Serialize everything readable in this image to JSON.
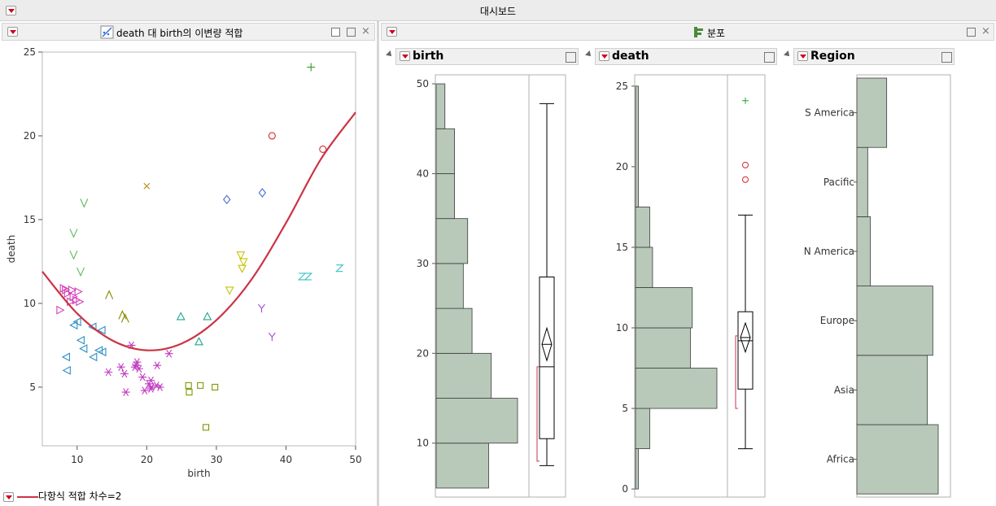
{
  "window": {
    "title": "대시보드"
  },
  "left_panel": {
    "title": "death 대 birth의 이변량 적합",
    "legend": "다항식 적합 차수=2"
  },
  "right_panel": {
    "title": "분포"
  },
  "distributions": [
    {
      "name": "birth"
    },
    {
      "name": "death"
    },
    {
      "name": "Region"
    }
  ],
  "chart_data": [
    {
      "type": "scatter",
      "xlabel": "birth",
      "ylabel": "death",
      "xlim": [
        5,
        50
      ],
      "ylim": [
        1.5,
        25
      ],
      "xticks": [
        10,
        20,
        30,
        40,
        50
      ],
      "yticks": [
        5,
        10,
        15,
        20,
        25
      ],
      "fit_line": {
        "label": "다항식 적합 차수=2",
        "color": "#cc3344",
        "points": [
          [
            5,
            11.9
          ],
          [
            10,
            9.4
          ],
          [
            15,
            7.8
          ],
          [
            20,
            7.2
          ],
          [
            25,
            7.6
          ],
          [
            30,
            9.0
          ],
          [
            35,
            11.4
          ],
          [
            40,
            14.8
          ],
          [
            45,
            18.6
          ],
          [
            50,
            21.4
          ]
        ]
      },
      "groups": [
        {
          "marker": "+",
          "color": "#2ca02c",
          "points": [
            [
              43.6,
              24.1
            ]
          ]
        },
        {
          "marker": "o",
          "color": "#d62728",
          "points": [
            [
              38.0,
              20.0
            ],
            [
              45.3,
              19.2
            ]
          ]
        },
        {
          "marker": "x",
          "color": "#b8860b",
          "points": [
            [
              20.0,
              17.0
            ]
          ]
        },
        {
          "marker": "diamond",
          "color": "#4a6fd4",
          "points": [
            [
              31.5,
              16.2
            ],
            [
              36.6,
              16.6
            ]
          ]
        },
        {
          "marker": "V",
          "color": "#5cb85c",
          "points": [
            [
              11.0,
              16.0
            ],
            [
              9.5,
              14.2
            ],
            [
              9.5,
              12.9
            ],
            [
              10.5,
              11.9
            ]
          ]
        },
        {
          "marker": "tri-down",
          "color": "#c9c100",
          "points": [
            [
              33.5,
              12.9
            ],
            [
              33.9,
              12.5
            ],
            [
              33.7,
              12.1
            ],
            [
              31.9,
              10.8
            ]
          ]
        },
        {
          "marker": "Z",
          "color": "#3bbfc4",
          "points": [
            [
              42.3,
              11.6
            ],
            [
              43.2,
              11.6
            ],
            [
              47.7,
              12.1
            ]
          ]
        },
        {
          "marker": "Y",
          "color": "#a04ad4",
          "points": [
            [
              36.5,
              9.7
            ],
            [
              38.0,
              8.0
            ]
          ]
        },
        {
          "marker": "A",
          "color": "#8a8a00",
          "points": [
            [
              14.6,
              10.5
            ],
            [
              16.5,
              9.3
            ],
            [
              16.9,
              9.1
            ]
          ]
        },
        {
          "marker": "tri-right",
          "color": "#d43fb8",
          "points": [
            [
              7.5,
              9.6
            ],
            [
              8.0,
              10.9
            ],
            [
              8.3,
              10.8
            ],
            [
              9.0,
              10.1
            ],
            [
              9.2,
              10.8
            ],
            [
              9.4,
              10.4
            ],
            [
              9.8,
              10.2
            ],
            [
              10.1,
              10.7
            ],
            [
              10.3,
              10.1
            ],
            [
              8.6,
              10.6
            ]
          ]
        },
        {
          "marker": "tri-up",
          "color": "#1aa88a",
          "points": [
            [
              24.9,
              9.2
            ],
            [
              28.7,
              9.2
            ],
            [
              27.5,
              7.7
            ]
          ]
        },
        {
          "marker": "tri-left",
          "color": "#2a8fc4",
          "points": [
            [
              9.6,
              8.7
            ],
            [
              10.1,
              8.9
            ],
            [
              12.3,
              8.6
            ],
            [
              13.6,
              8.4
            ],
            [
              10.6,
              7.8
            ],
            [
              12.4,
              6.8
            ],
            [
              11.0,
              7.3
            ],
            [
              13.2,
              7.2
            ],
            [
              13.7,
              7.1
            ],
            [
              8.5,
              6.8
            ],
            [
              8.6,
              6.0
            ]
          ]
        },
        {
          "marker": "asterisk",
          "color": "#c23ac2",
          "points": [
            [
              17.8,
              7.5
            ],
            [
              14.5,
              5.9
            ],
            [
              16.3,
              6.2
            ],
            [
              16.8,
              5.8
            ],
            [
              17.0,
              4.7
            ],
            [
              18.5,
              6.3
            ],
            [
              18.9,
              6.1
            ],
            [
              19.4,
              5.6
            ],
            [
              19.7,
              4.8
            ],
            [
              20.3,
              5.2
            ],
            [
              20.6,
              5.4
            ],
            [
              20.7,
              5.0
            ],
            [
              21.5,
              6.3
            ],
            [
              21.9,
              5.0
            ],
            [
              21.4,
              5.1
            ],
            [
              23.2,
              7.0
            ],
            [
              18.6,
              6.5
            ],
            [
              18.3,
              6.2
            ],
            [
              20.6,
              4.9
            ]
          ]
        },
        {
          "marker": "square",
          "color": "#7a9a00",
          "points": [
            [
              26.0,
              5.1
            ],
            [
              26.1,
              4.7
            ],
            [
              27.7,
              5.1
            ],
            [
              29.8,
              5.0
            ],
            [
              28.5,
              2.6
            ]
          ]
        }
      ]
    },
    {
      "type": "histogram",
      "name": "birth",
      "ylim": [
        4,
        51
      ],
      "yticks": [
        10,
        20,
        30,
        40,
        50
      ],
      "bins": [
        [
          5,
          10,
          6
        ],
        [
          10,
          15,
          9.3
        ],
        [
          15,
          20,
          6.3
        ],
        [
          20,
          25,
          4.1
        ],
        [
          25,
          30,
          3.1
        ],
        [
          30,
          35,
          3.6
        ],
        [
          35,
          40,
          2.1
        ],
        [
          40,
          45,
          2.1
        ],
        [
          45,
          50,
          1.0
        ]
      ],
      "box": {
        "min": 7.5,
        "q1": 10.5,
        "median": 18.5,
        "q3": 28.5,
        "max": 47.8,
        "mean": 21.0,
        "ci": [
          19.2,
          22.8
        ],
        "shortest_half": [
          8.0,
          18.5
        ]
      }
    },
    {
      "type": "histogram",
      "name": "death",
      "ylim": [
        -0.5,
        25.7
      ],
      "yticks": [
        0,
        5,
        10,
        15,
        20,
        25
      ],
      "bins": [
        [
          0,
          2.5,
          0.3
        ],
        [
          2.5,
          5,
          1.5
        ],
        [
          5,
          7.5,
          8.6
        ],
        [
          7.5,
          10,
          5.8
        ],
        [
          10,
          12.5,
          6.0
        ],
        [
          12.5,
          15,
          1.8
        ],
        [
          15,
          17.5,
          1.5
        ],
        [
          17.5,
          25,
          0.3
        ]
      ],
      "box": {
        "min": 2.5,
        "q1": 6.2,
        "median": 9.2,
        "q3": 11.0,
        "max": 17.0,
        "mean": 9.4,
        "ci": [
          8.5,
          10.3
        ],
        "shortest_half": [
          5.0,
          9.5
        ]
      },
      "outliers": [
        {
          "v": 24.1,
          "marker": "+",
          "color": "#2ca02c"
        },
        {
          "v": 20.1,
          "marker": "o",
          "color": "#d62728"
        },
        {
          "v": 19.2,
          "marker": "o",
          "color": "#d62728"
        }
      ]
    },
    {
      "type": "bar",
      "name": "Region",
      "categories": [
        "Africa",
        "Asia",
        "Europe",
        "N America",
        "Pacific",
        "S America"
      ],
      "values": [
        30,
        26,
        28,
        5,
        4,
        11
      ]
    }
  ]
}
